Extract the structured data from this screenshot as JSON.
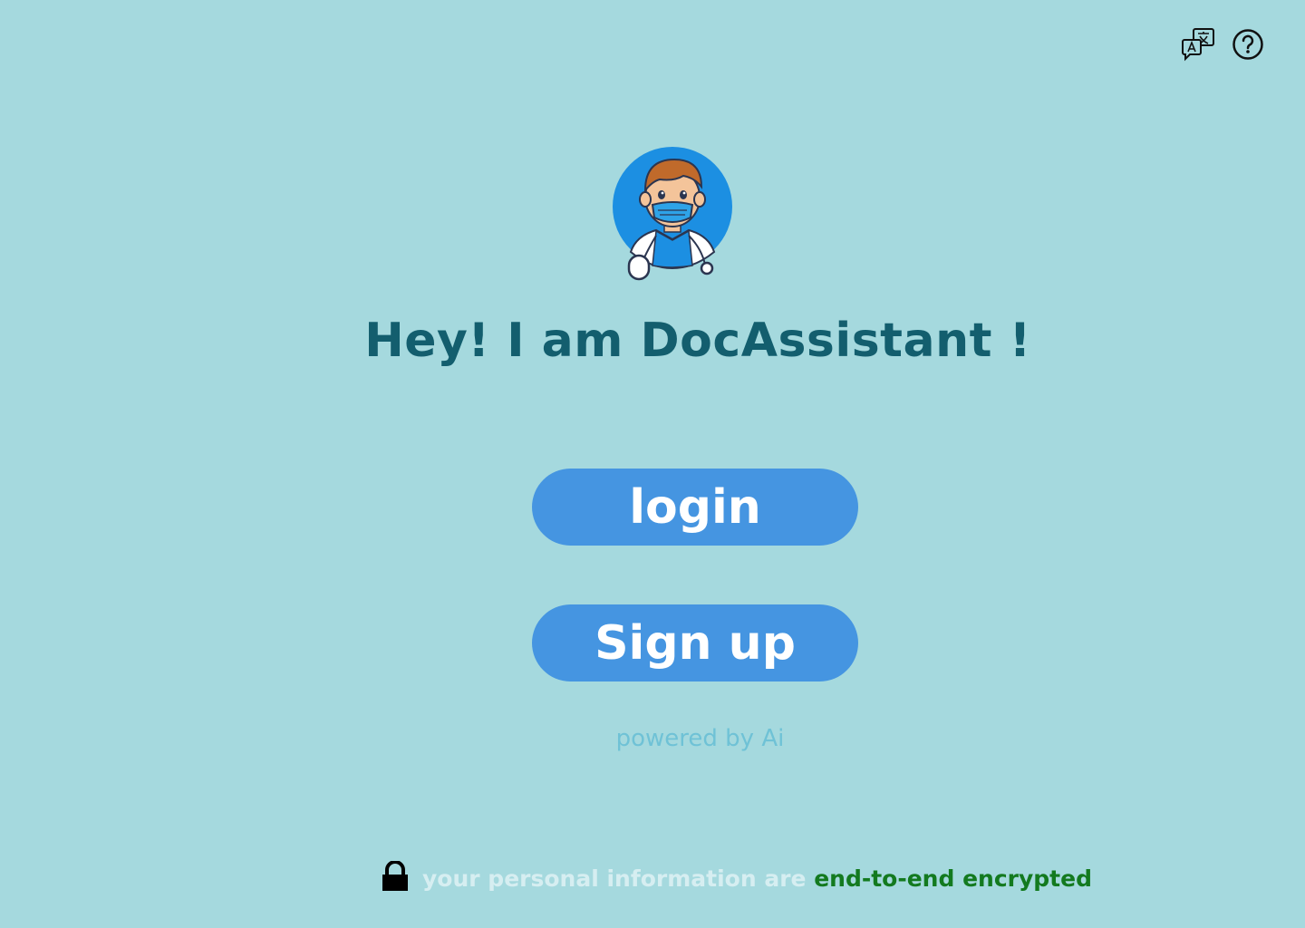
{
  "header": {
    "translate_icon": "translate-icon",
    "help_icon": "help-icon"
  },
  "avatar": {
    "icon": "doctor-avatar-icon"
  },
  "main": {
    "headline": "Hey! I am DocAssistant !",
    "login_label": "login",
    "signup_label": "Sign up",
    "powered_by": "powered by Ai"
  },
  "footer": {
    "lock_icon": "lock-icon",
    "text_plain": "your personal information are ",
    "text_accent": "end-to-end encrypted"
  },
  "colors": {
    "background": "#A5D9DE",
    "headline": "#135E6E",
    "button": "#4595E1",
    "powered_by": "#6FC2D6",
    "encrypted_accent": "#137A1F"
  }
}
